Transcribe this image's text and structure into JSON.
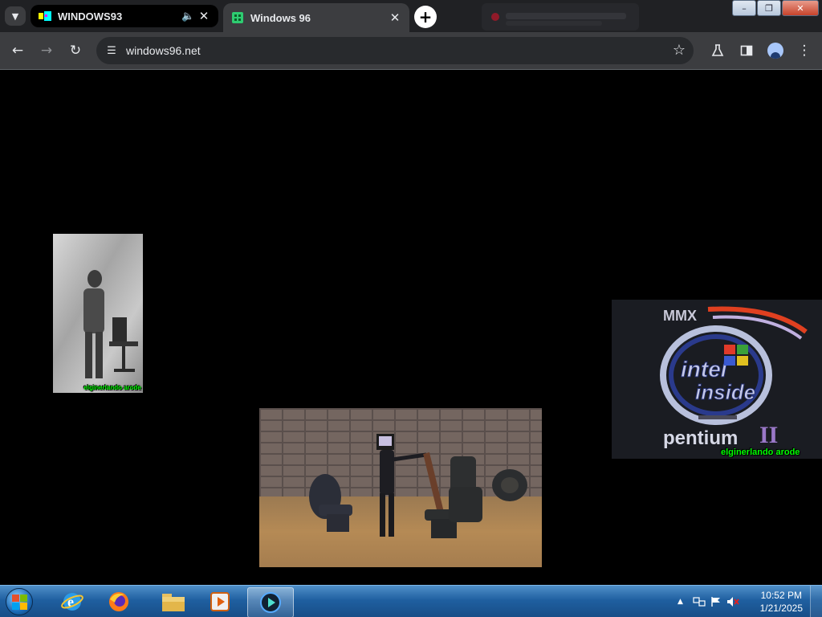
{
  "browser": {
    "tabs": [
      {
        "title": "WINDOWS93",
        "audio": true
      },
      {
        "title": "Windows 96",
        "audio": false
      }
    ],
    "address": "windows96.net"
  },
  "page": {
    "panes": [
      {
        "caption": "elginerlando arode"
      },
      {
        "caption": ""
      },
      {
        "caption": "elginerlando arode",
        "logo_top": "MMX",
        "logo_text_1": "intel",
        "logo_text_2": "inside",
        "logo_brand": "pentium",
        "logo_numeral": "II"
      }
    ]
  },
  "taskbar": {
    "apps": [
      "internet-explorer",
      "firefox",
      "file-explorer",
      "media-player",
      "windows96-app"
    ],
    "time": "10:52 PM",
    "date": "1/21/2025"
  },
  "colors": {
    "caption": "#00ff00",
    "tab_bg": "#202124",
    "toolbar_bg": "#3c3d40",
    "taskbar": "#1f5fa0"
  }
}
